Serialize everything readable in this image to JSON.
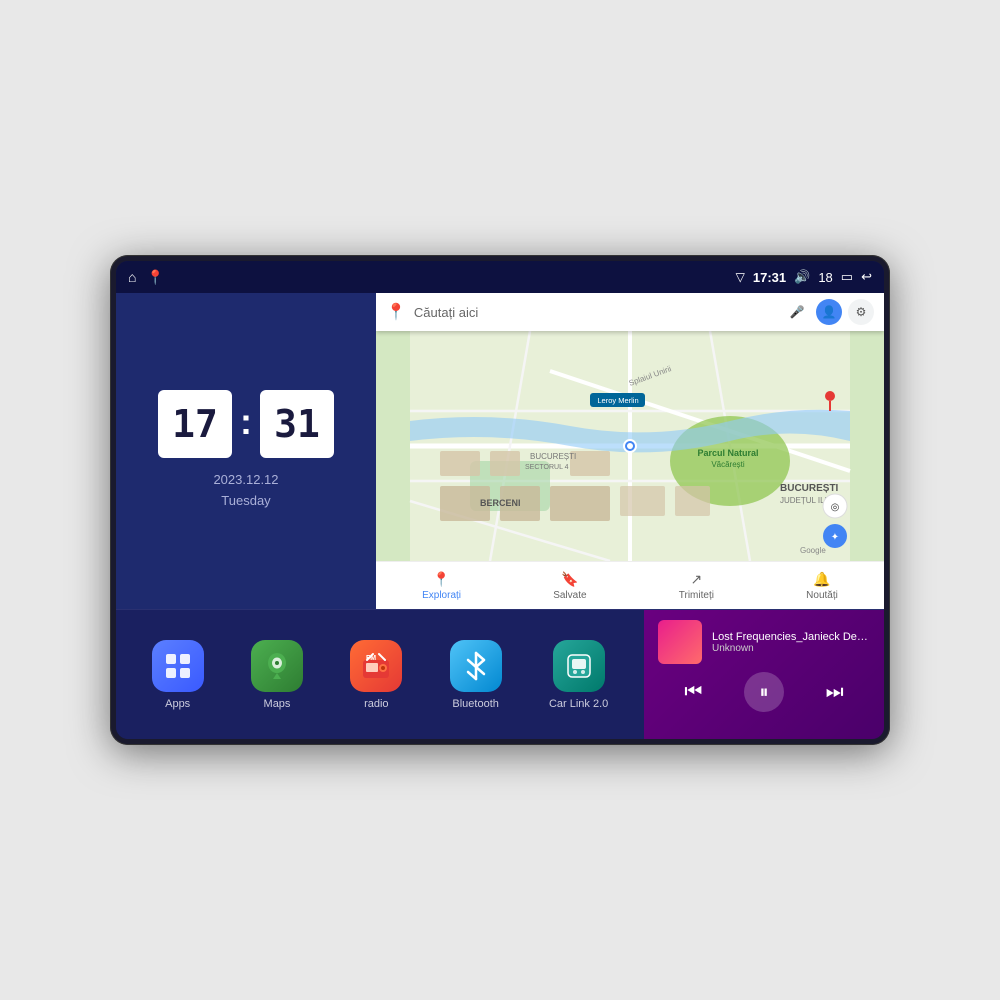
{
  "device": {
    "status_bar": {
      "left_icons": [
        "home",
        "maps-pin"
      ],
      "time": "17:31",
      "volume_icon": "🔊",
      "battery_level": "18",
      "battery_icon": "🔋",
      "back_icon": "↩"
    },
    "clock": {
      "hour": "17",
      "minute": "31",
      "date": "2023.12.12",
      "day": "Tuesday"
    },
    "map": {
      "search_placeholder": "Căutați aici",
      "nav_items": [
        {
          "label": "Explorați",
          "active": true
        },
        {
          "label": "Salvate",
          "active": false
        },
        {
          "label": "Trimiteți",
          "active": false
        },
        {
          "label": "Noutăți",
          "active": false
        }
      ]
    },
    "apps": [
      {
        "label": "Apps",
        "icon_type": "apps"
      },
      {
        "label": "Maps",
        "icon_type": "maps"
      },
      {
        "label": "radio",
        "icon_type": "radio"
      },
      {
        "label": "Bluetooth",
        "icon_type": "bluetooth"
      },
      {
        "label": "Car Link 2.0",
        "icon_type": "carlink"
      }
    ],
    "music": {
      "title": "Lost Frequencies_Janieck Devy-...",
      "artist": "Unknown",
      "controls": {
        "prev": "⏮",
        "play": "⏸",
        "next": "⏭"
      }
    }
  }
}
